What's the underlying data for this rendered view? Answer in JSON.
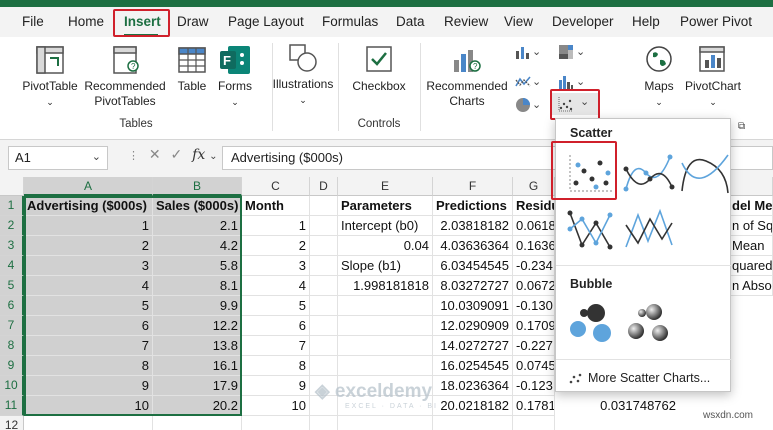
{
  "tabs": [
    "File",
    "Home",
    "Insert",
    "Draw",
    "Page Layout",
    "Formulas",
    "Data",
    "Review",
    "View",
    "Developer",
    "Help",
    "Power Pivot"
  ],
  "active_tab": "Insert",
  "ribbon": {
    "pivottable": "PivotTable",
    "rec_pivot_1": "Recommended",
    "rec_pivot_2": "PivotTables",
    "table": "Table",
    "forms": "Forms",
    "tables_group": "Tables",
    "illustrations": "Illustrations",
    "checkbox": "Checkbox",
    "controls_group": "Controls",
    "rec_charts_1": "Recommended",
    "rec_charts_2": "Charts",
    "maps": "Maps",
    "pivotchart": "PivotChart"
  },
  "formula_bar": {
    "name_box": "A1",
    "fx": "fx",
    "content": "Advertising ($000s)"
  },
  "columns": [
    "A",
    "B",
    "C",
    "D",
    "E",
    "F",
    "G"
  ],
  "rows": [
    "1",
    "2",
    "3",
    "4",
    "5",
    "6",
    "7",
    "8",
    "9",
    "10",
    "11",
    "12"
  ],
  "cells": {
    "A": [
      "Advertising ($000s)",
      "1",
      "2",
      "3",
      "4",
      "5",
      "6",
      "7",
      "8",
      "9",
      "10"
    ],
    "B": [
      "Sales ($000s)",
      "2.1",
      "4.2",
      "5.8",
      "8.1",
      "9.9",
      "12.2",
      "13.8",
      "16.1",
      "17.9",
      "20.2"
    ],
    "C": [
      "Month",
      "1",
      "2",
      "3",
      "4",
      "5",
      "6",
      "7",
      "8",
      "9",
      "10"
    ],
    "E": [
      "Parameters",
      "Intercept (b0)",
      "0.04",
      "Slope (b1)",
      "1.998181818",
      "",
      "",
      "",
      "",
      "",
      ""
    ],
    "F": [
      "Predictions",
      "2.03818182",
      "4.03636364",
      "6.03454545",
      "8.03272727",
      "10.0309091",
      "12.0290909",
      "14.0272727",
      "16.0254545",
      "18.0236364",
      "20.0218182"
    ],
    "G": [
      "Residu",
      "0.0618",
      "0.1636",
      "-0.234",
      "0.0672",
      "-0.130",
      "0.1709",
      "-0.227",
      "0.0745",
      "-0.123",
      "0.1781818"
    ],
    "G11_extra": "0.031748762",
    "H": [
      "del Met",
      "n of Squ",
      "Mean",
      "quared",
      "n Abso"
    ]
  },
  "dropdown": {
    "scatter_heading": "Scatter",
    "bubble_heading": "Bubble",
    "more": "More Scatter Charts..."
  },
  "watermark": {
    "brand": "exceldemy",
    "tagline": "EXCEL · DATA · BI",
    "site": "wsxdn.com"
  },
  "colors": {
    "excel_green": "#1d6f42",
    "highlight_red": "#d0202b"
  }
}
